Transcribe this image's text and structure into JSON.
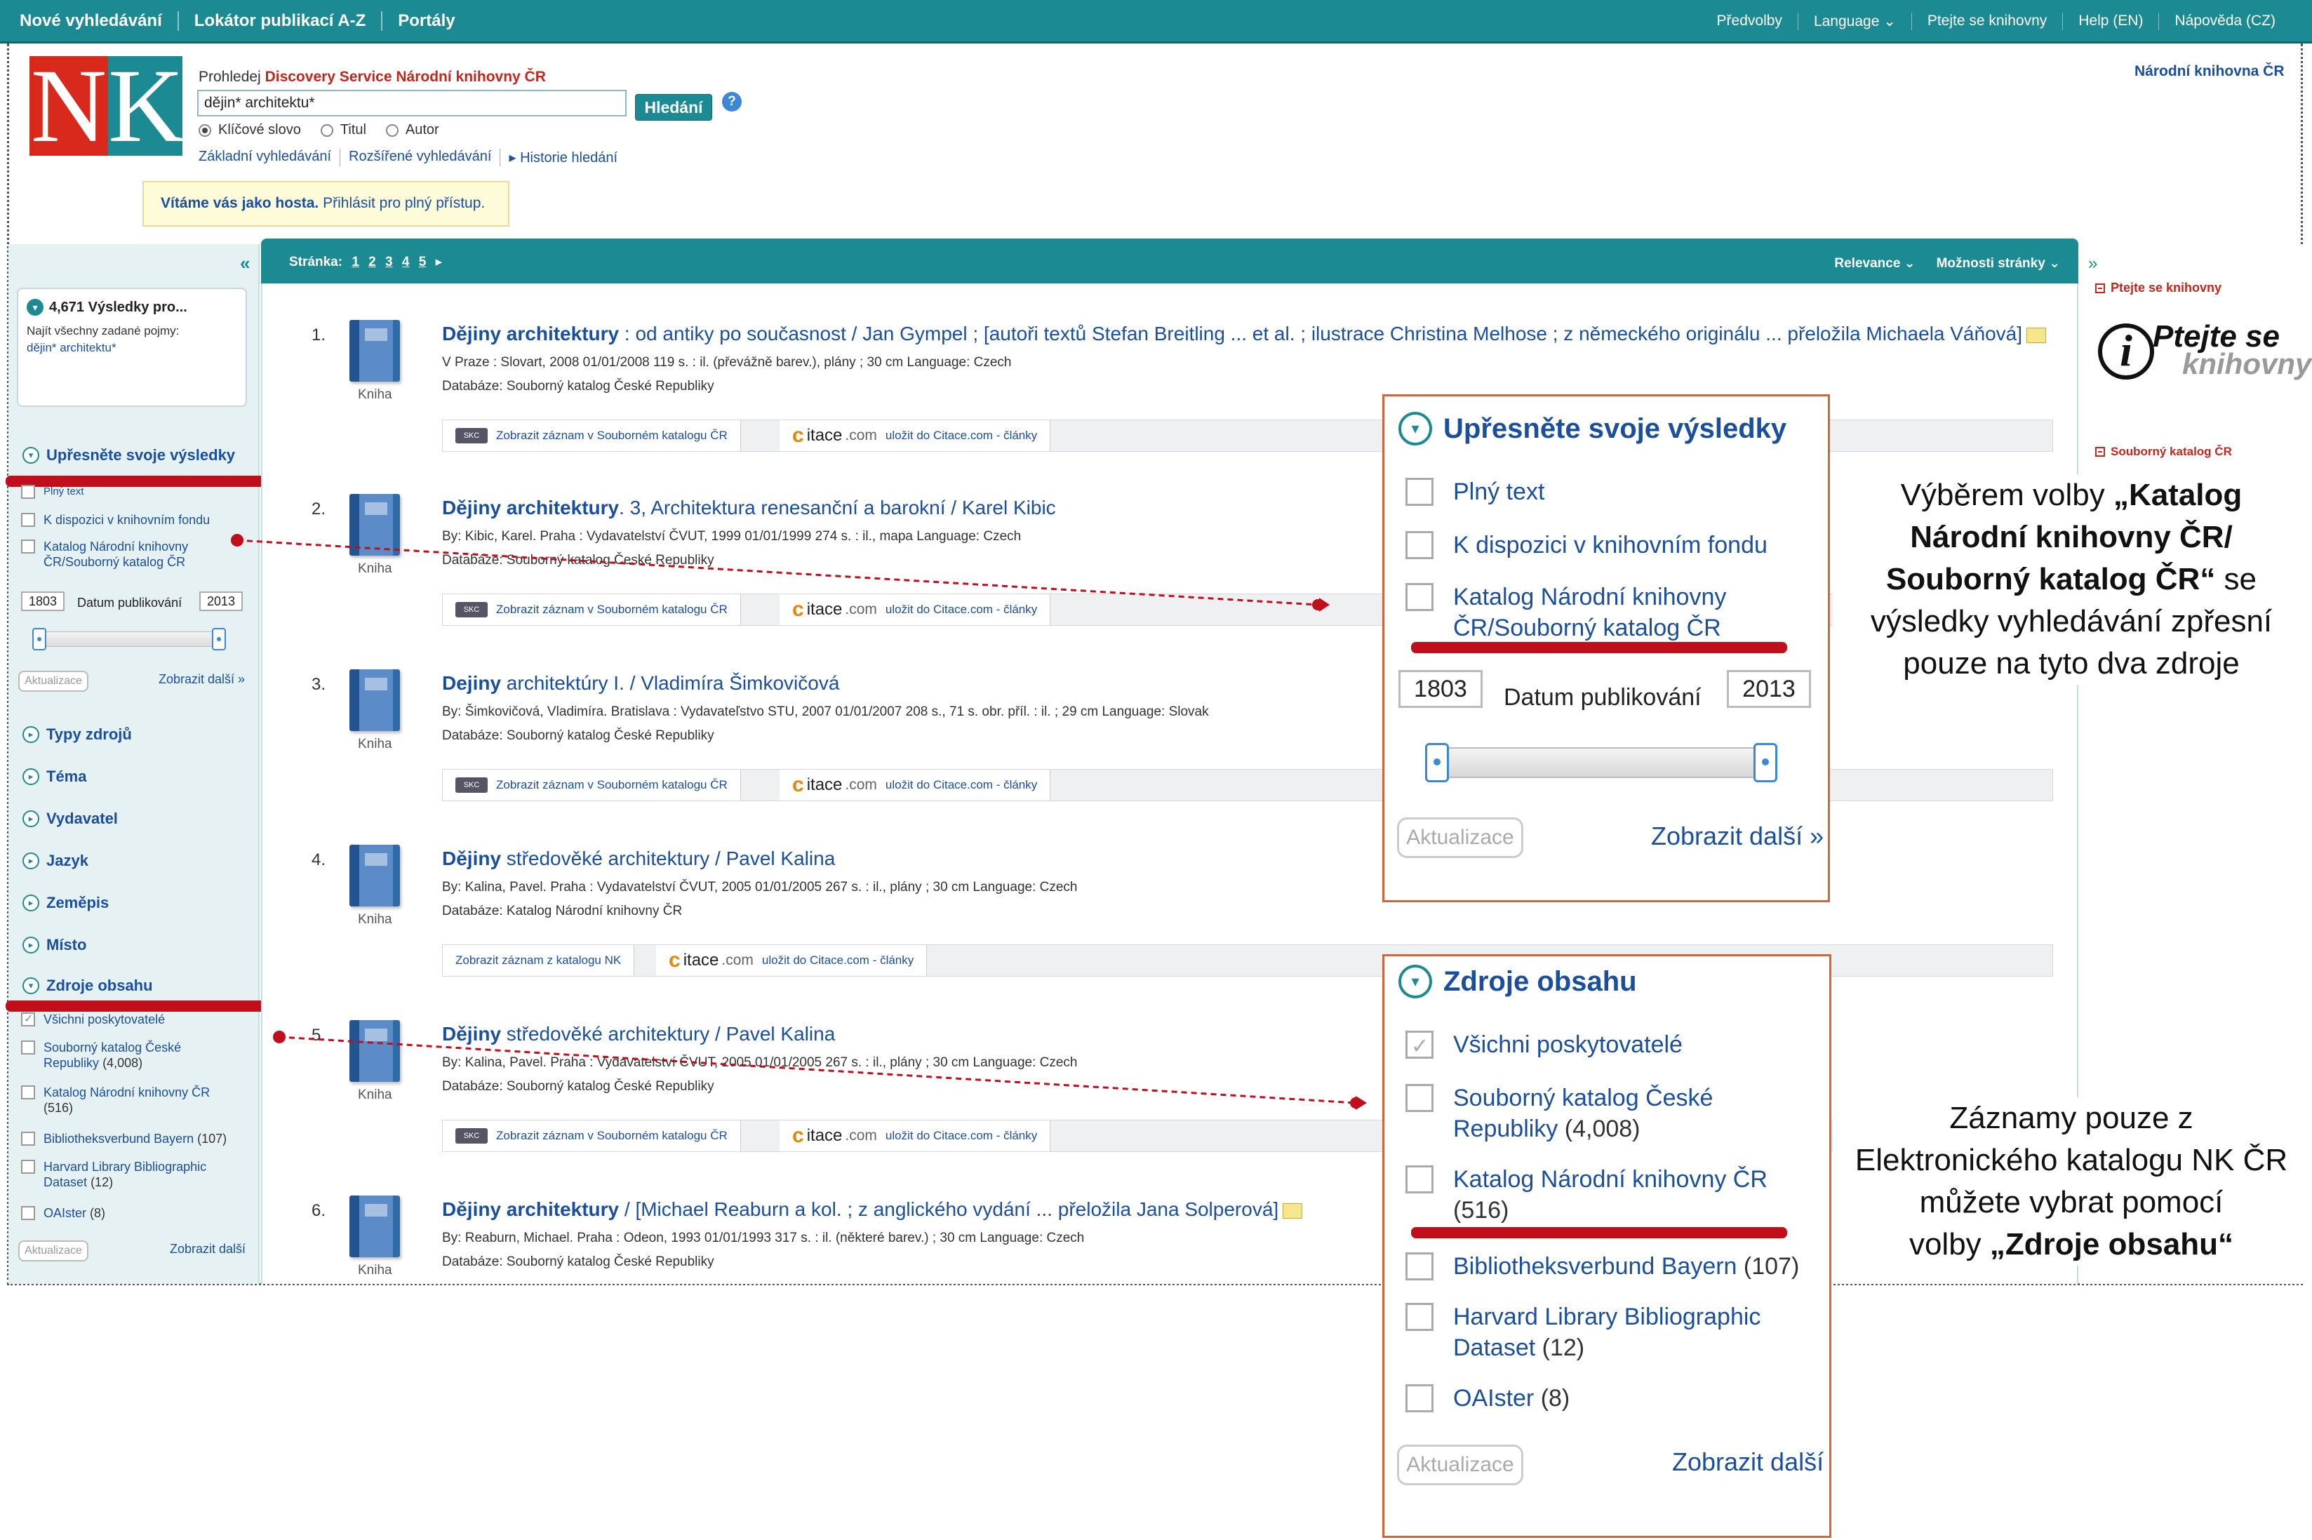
{
  "topbar": {
    "left": [
      "Nové vyhledávání",
      "Lokátor publikací A-Z",
      "Portály"
    ],
    "right": [
      "Předvolby",
      "Language ⌄",
      "Ptejte se knihovny",
      "Help (EN)",
      "Nápověda (CZ)"
    ]
  },
  "header": {
    "search_caption_prefix": "Prohledej",
    "search_caption_brand": "Discovery Service Národní knihovny ČR",
    "search_value": "dějin* architektu*",
    "search_button": "Hledání",
    "help": "?",
    "radios": [
      "Klíčové slovo",
      "Titul",
      "Autor"
    ],
    "links": [
      "Základní vyhledávání",
      "Rozšířené vyhledávání",
      "▸ Historie hledání"
    ],
    "guest_bold": "Vítáme vás jako hosta.",
    "guest_text": "Přihlásit pro plný přístup.",
    "nk_link": "Národní knihovna ČR",
    "logo_n": "N",
    "logo_k": "K"
  },
  "sidebar": {
    "collapse": "«",
    "results_count": "4,671 Výsledky pro...",
    "results_sub": "Najít všechny zadané pojmy:",
    "results_query": "dějin* architektu*",
    "refine_title": "Upřesněte svoje výsledky",
    "refine_items": [
      "Plný text",
      "K dispozici v knihovním fondu",
      "Katalog Národní knihovny ČR/Souborný katalog ČR"
    ],
    "year_from": "1803",
    "year_label": "Datum publikování",
    "year_to": "2013",
    "update_btn": "Aktualizace",
    "more_link": "Zobrazit další »",
    "facets": [
      "Typy zdrojů",
      "Téma",
      "Vydavatel",
      "Jazyk",
      "Zeměpis",
      "Místo"
    ],
    "sources_title": "Zdroje obsahu",
    "source_items": [
      {
        "label": "Všichni poskytovatelé",
        "count": ""
      },
      {
        "label": "Souborný katalog České Republiky",
        "count": "(4,008)"
      },
      {
        "label": "Katalog Národní knihovny ČR",
        "count": "(516)"
      },
      {
        "label": "Bibliotheksverbund Bayern",
        "count": "(107)"
      },
      {
        "label": "Harvard Library Bibliographic Dataset",
        "count": "(12)"
      },
      {
        "label": "OAIster",
        "count": "(8)"
      }
    ],
    "sources_update": "Aktualizace",
    "sources_more": "Zobrazit další"
  },
  "results_bar": {
    "page_label": "Stránka:",
    "pages": [
      "1",
      "2",
      "3",
      "4",
      "5"
    ],
    "next": "▸",
    "relevance": "Relevance ⌄",
    "options": "Možnosti stránky ⌄"
  },
  "results": [
    {
      "num": "1.",
      "type": "Kniha",
      "title_bold": "Dějiny architektury",
      "title_rest": " : od antiky po současnost / Jan Gympel ; [autoři textů Stefan Breitling ... et al. ; ilustrace Christina Melhose ; z německého originálu ... přeložila Michaela Váňová]",
      "meta": "V Praze : Slovart, 2008 01/01/2008 119 s. : il. (převážně barev.), plány ; 30 cm Language: Czech",
      "db": "Databáze: Souborný katalog České Republiky",
      "link": "Zobrazit záznam v Souborném katalogu ČR",
      "note": true
    },
    {
      "num": "2.",
      "type": "Kniha",
      "title_bold": "Dějiny architektury",
      "title_rest": ". 3, Architektura renesanční a barokní / Karel Kibic",
      "meta": "By: Kibic, Karel. Praha : Vydavatelství ČVUT, 1999 01/01/1999 274 s. : il., mapa Language: Czech",
      "db": "Databáze: Souborný katalog České Republiky",
      "link": "Zobrazit záznam v Souborném katalogu ČR",
      "note": false
    },
    {
      "num": "3.",
      "type": "Kniha",
      "title_bold": "Dejiny",
      "title_rest": " architektúry I. / Vladimíra Šimkovičová",
      "meta": "By: Šimkovičová, Vladimíra. Bratislava : Vydavateľstvo STU, 2007 01/01/2007 208 s., 71 s. obr. příl. : il. ; 29 cm Language: Slovak",
      "db": "Databáze: Souborný katalog České Republiky",
      "link": "Zobrazit záznam v Souborném katalogu ČR",
      "note": false
    },
    {
      "num": "4.",
      "type": "Kniha",
      "title_bold": "Dějiny",
      "title_rest": " středověké architektury / Pavel Kalina",
      "meta": "By: Kalina, Pavel. Praha : Vydavatelství ČVUT, 2005 01/01/2005 267 s. : il., plány ; 30 cm Language: Czech",
      "db": "Databáze: Katalog Národní knihovny ČR",
      "link": "Zobrazit záznam z katalogu NK",
      "note": false
    },
    {
      "num": "5.",
      "type": "Kniha",
      "title_bold": "Dějiny",
      "title_rest": " středověké architektury / Pavel Kalina",
      "meta": "By: Kalina, Pavel. Praha : Vydavatelství ČVUT, 2005 01/01/2005 267 s. : il., plány ; 30 cm Language: Czech",
      "db": "Databáze: Souborný katalog České Republiky",
      "link": "Zobrazit záznam v Souborném katalogu ČR",
      "note": false
    },
    {
      "num": "6.",
      "type": "Kniha",
      "title_bold": "Dějiny architektury",
      "title_rest": " / [Michael Reaburn a kol. ; z anglického vydání ... přeložila Jana Solperová]",
      "meta": "By: Reaburn, Michael. Praha : Odeon, 1993 01/01/1993 317 s. : il. (některé barev.) ; 30 cm Language: Czech",
      "db": "Databáze: Souborný katalog České Republiky",
      "link": "",
      "note": true
    }
  ],
  "result_bar": {
    "citace_c": "c",
    "citace_name": "itace",
    "citace_dom": ".com",
    "save": "uložit do Citace.com - články",
    "skc": "SKC"
  },
  "right": {
    "collapse": "»",
    "ask_head": "Ptejte se knihovny",
    "ask_logo_i": "i",
    "ask_logo_t1": "Ptejte se",
    "ask_logo_t2": "knihovny",
    "skc_head": "Souborný katalog ČR"
  },
  "zoom_refine": {
    "title": "Upřesněte svoje výsledky",
    "items": [
      "Plný text",
      "K dispozici v knihovním fondu"
    ],
    "item3_line1": "Katalog Národní knihovny",
    "item3_line2": "ČR/Souborný katalog ČR",
    "year_from": "1803",
    "year_label": "Datum publikování",
    "year_to": "2013",
    "update": "Aktualizace",
    "more": "Zobrazit další »"
  },
  "zoom_sources": {
    "title": "Zdroje obsahu",
    "items": [
      {
        "l1": "Všichni poskytovatelé",
        "l2": "",
        "count": ""
      },
      {
        "l1": "Souborný katalog České",
        "l2": "Republiky",
        "count": "(4,008)"
      },
      {
        "l1": "Katalog Národní knihovny ČR",
        "l2": "",
        "count": "(516)"
      },
      {
        "l1": "Bibliotheksverbund Bayern",
        "l2": "",
        "count": "(107)"
      },
      {
        "l1": "Harvard Library Bibliographic",
        "l2": "Dataset",
        "count": "(12)"
      },
      {
        "l1": "OAIster",
        "l2": "",
        "count": "(8)"
      }
    ],
    "update": "Aktualizace",
    "more": "Zobrazit další"
  },
  "callout1": {
    "l1_pre": "Výběrem volby ",
    "l1_b": "„Katalog",
    "l2_b": "Národní knihovny ČR/",
    "l3_b": "Souborný katalog ČR“",
    "l3_post": " se",
    "l4": "výsledky vyhledávání zpřesní",
    "l5": "pouze na tyto dva zdroje"
  },
  "callout2": {
    "l1": "Záznamy pouze z",
    "l2": "Elektronického katalogu NK ČR",
    "l3": "můžete vybrat pomocí",
    "l4_pre": "volby ",
    "l4_b": "„Zdroje obsahu“"
  },
  "colors": {
    "teal": "#1c8a93",
    "red_mark": "#c00e1a",
    "link": "#1a4f9e",
    "panel_border": "#d4643c"
  }
}
